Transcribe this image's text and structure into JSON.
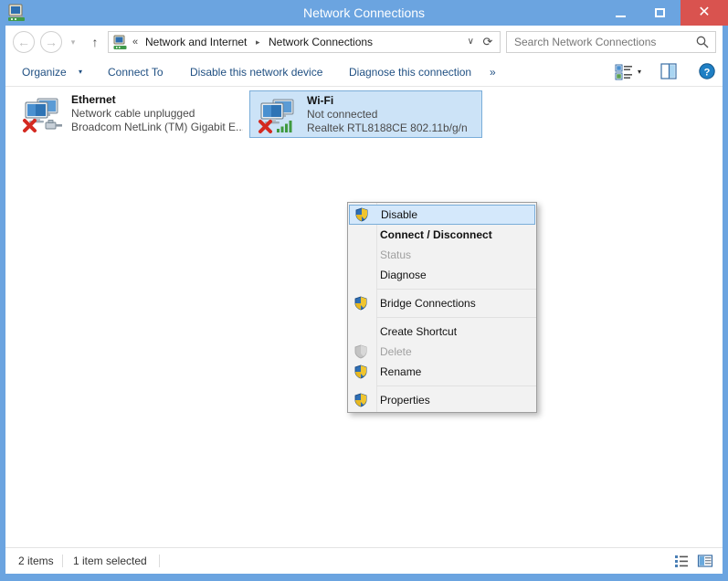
{
  "window": {
    "title": "Network Connections",
    "app_icon": "network-connections-icon",
    "frame_color": "#6ba4e0",
    "controls": {
      "minimize": "minimize-button",
      "maximize": "maximize-button",
      "close_label": "✕",
      "close_color": "#d9534f"
    }
  },
  "address_bar": {
    "back_label": "←",
    "forward_label": "→",
    "history_label": "▾",
    "up_label": "↑",
    "crumb_icon": "network-folder-icon",
    "double_chevron": "«",
    "crumb_first": "Network and Internet",
    "crumb_arrow": "▸",
    "crumb_second": "Network Connections",
    "dropdown_label": "∨",
    "refresh_label": "⟳"
  },
  "search": {
    "placeholder": "Search Network Connections",
    "icon": "search-icon"
  },
  "toolbar": {
    "organize": "Organize",
    "organize_caret": "▾",
    "connect_to": "Connect To",
    "disable_device": "Disable this network device",
    "diagnose_connection": "Diagnose this connection",
    "more_label": "»",
    "view_icon": "change-view-icon",
    "view_caret": "▾",
    "preview_pane_icon": "preview-pane-icon",
    "help_icon": "help-icon",
    "link_color": "#1f4f82"
  },
  "connections": [
    {
      "name": "Ethernet",
      "status": "Network cable unplugged",
      "adapter": "Broadcom NetLink (TM) Gigabit E...",
      "icon": "ethernet-adapter-icon",
      "overlay": "red-x-error",
      "selected": false
    },
    {
      "name": "Wi-Fi",
      "status": "Not connected",
      "adapter": "Realtek RTL8188CE 802.11b/g/n",
      "icon": "wifi-adapter-icon",
      "overlay": "red-x-error",
      "selected": true
    }
  ],
  "context_menu": {
    "items": [
      {
        "label": "Disable",
        "shield": true,
        "state": "highlighted"
      },
      {
        "label": "Connect / Disconnect",
        "shield": false,
        "state": "default"
      },
      {
        "label": "Status",
        "shield": false,
        "state": "disabled"
      },
      {
        "label": "Diagnose",
        "shield": false,
        "state": "normal"
      },
      {
        "label": "Bridge Connections",
        "shield": true,
        "state": "normal"
      },
      {
        "label": "Create Shortcut",
        "shield": false,
        "state": "normal"
      },
      {
        "label": "Delete",
        "shield": true,
        "state": "disabled"
      },
      {
        "label": "Rename",
        "shield": true,
        "state": "normal"
      },
      {
        "label": "Properties",
        "shield": true,
        "state": "normal"
      }
    ]
  },
  "status_bar": {
    "item_count": "2 items",
    "selection": "1 item selected",
    "list_view_icon": "list-view-icon",
    "details_view_icon": "details-view-icon"
  }
}
